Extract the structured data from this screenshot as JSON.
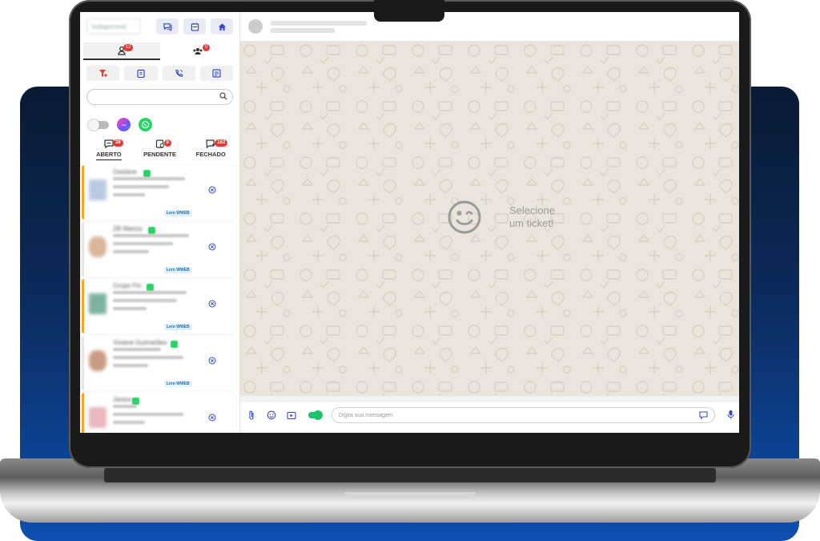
{
  "colors": {
    "accent": "#3849c7",
    "badge": "#e53935",
    "ticket_border_open": "#f5a623",
    "whatsapp": "#25d366",
    "chat_bg": "#eae4dc",
    "backdrop_top": "#0a1a33",
    "backdrop_bottom": "#0d4fb0"
  },
  "sidebar": {
    "user_select_placeholder": "Indisponível",
    "top_buttons": [
      {
        "icon": "chat-icon"
      },
      {
        "icon": "calendar-icon"
      },
      {
        "icon": "home-icon"
      }
    ],
    "top_tabs": [
      {
        "icon": "user-icon",
        "badge": "12"
      },
      {
        "icon": "group-icon",
        "badge": "0"
      }
    ],
    "tools": [
      {
        "icon": "filter-add-icon"
      },
      {
        "icon": "clipboard-icon"
      },
      {
        "icon": "phone-refresh-icon"
      },
      {
        "icon": "notes-icon"
      }
    ],
    "search": {
      "placeholder": ""
    },
    "channels": [
      "toggle",
      "messenger-icon",
      "whatsapp-icon"
    ],
    "status_tabs": [
      {
        "label": "ABERTO",
        "badge": "39",
        "icon": "chat-bubble-icon"
      },
      {
        "label": "PENDENTE",
        "badge": "0",
        "icon": "pending-icon"
      },
      {
        "label": "FECHADO",
        "badge": "162",
        "icon": "closed-icon"
      }
    ],
    "tickets": [
      {
        "name": "Gesiane",
        "tag": "Lero WWEB",
        "open": true
      },
      {
        "name": "ZB Mariza",
        "tag": "Lero WWEB",
        "open": false
      },
      {
        "name": "Grupo Fin",
        "tag": "Lero WWEB",
        "open": true
      },
      {
        "name": "Viviane Guimarães",
        "tag": "Lero WWEB",
        "open": false
      },
      {
        "name": "Janice",
        "tag": "",
        "open": true
      }
    ]
  },
  "chat": {
    "empty_line1": "Selecione",
    "empty_line2": "um ticket!",
    "input_placeholder": "Digita sua mensagem"
  }
}
